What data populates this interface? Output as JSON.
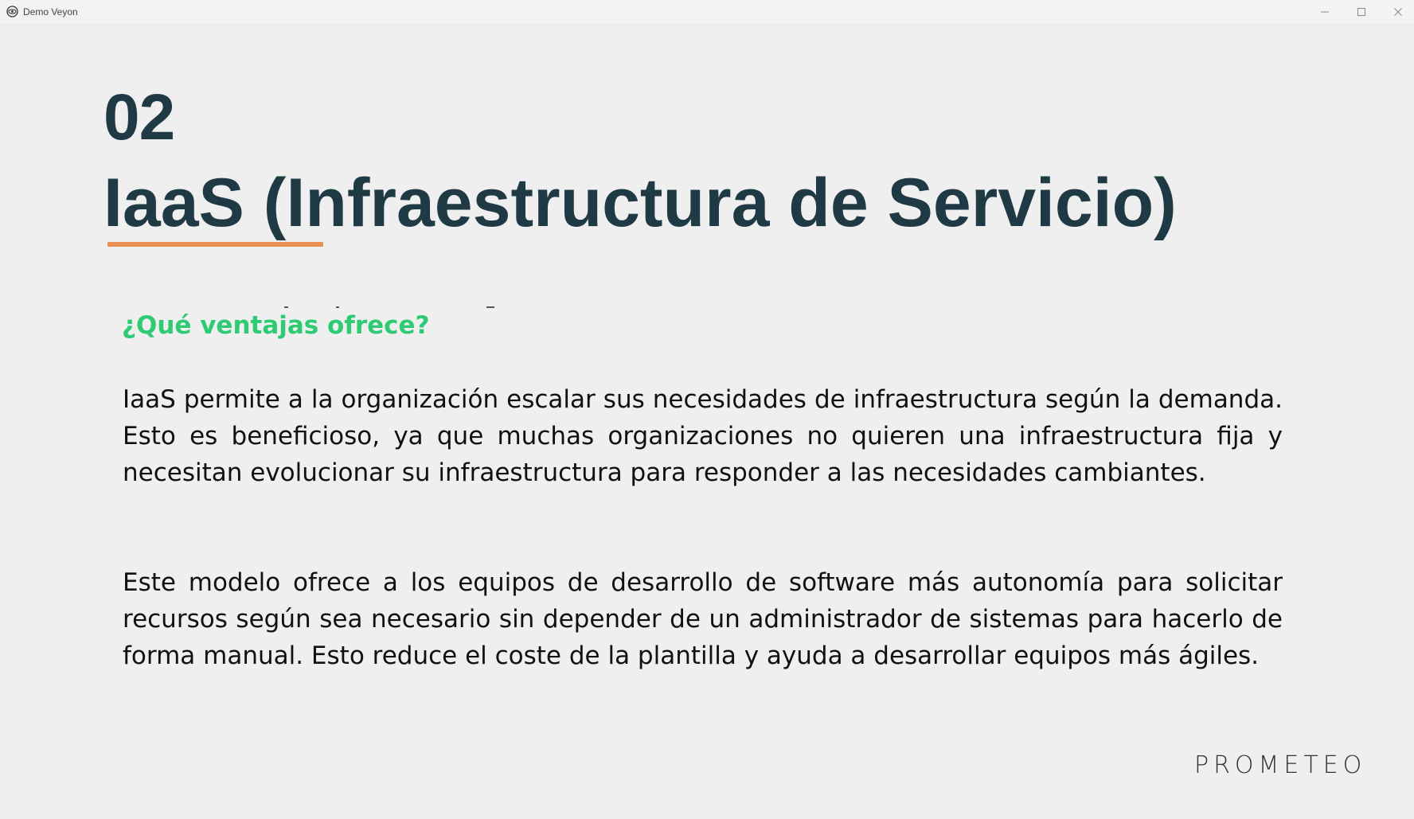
{
  "window": {
    "title": "Demo Veyon",
    "controls": {
      "minimize_icon": "minimize-icon",
      "maximize_icon": "maximize-icon",
      "close_icon": "close-icon"
    }
  },
  "slide": {
    "number": "02",
    "title": "IaaS (Infraestructura de Servicio)",
    "section_heading": "¿Qué ventajas ofrece?",
    "paragraphs": [
      "IaaS permite a la organización escalar sus necesidades de infraestructura según la demanda. Esto es beneficioso, ya que muchas organizaciones no quieren una infraestructura fija y necesitan evolucionar su infraestructura para responder a las necesidades cambiantes.",
      "Este modelo ofrece a los equipos de desarrollo de software más autonomía para solicitar recursos según sea necesario sin depender de un administrador de sistemas para hacerlo de forma manual. Esto reduce el coste de la plantilla y ayuda a desarrollar equipos más ágiles."
    ],
    "brand": "PROMETEO"
  },
  "colors": {
    "title": "#1f3a45",
    "accent_underline": "#e98f56",
    "heading_green": "#2fcb74",
    "background": "#efefef"
  }
}
